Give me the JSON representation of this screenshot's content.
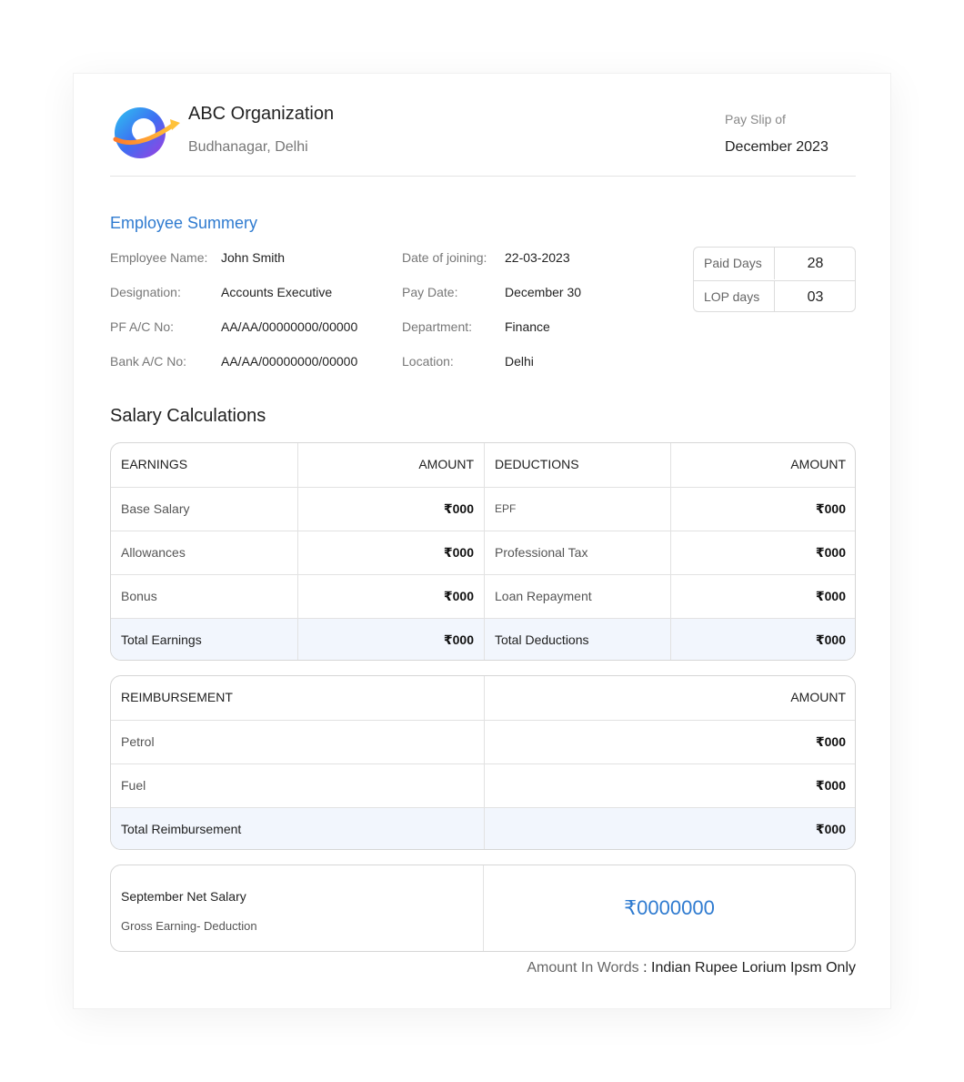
{
  "header": {
    "org_name": "ABC Organization",
    "org_address": "Budhanagar, Delhi",
    "payslip_label": "Pay Slip of",
    "payslip_month": "December 2023"
  },
  "summary": {
    "title": "Employee Summery",
    "left": [
      {
        "label": "Employee Name:",
        "value": "John Smith"
      },
      {
        "label": "Designation:",
        "value": "Accounts Executive"
      },
      {
        "label": "PF A/C No:",
        "value": "AA/AA/00000000/00000"
      },
      {
        "label": "Bank A/C No:",
        "value": "AA/AA/00000000/00000"
      }
    ],
    "right": [
      {
        "label": "Date of joining:",
        "value": "22-03-2023"
      },
      {
        "label": "Pay Date:",
        "value": "December 30"
      },
      {
        "label": "Department:",
        "value": "Finance"
      },
      {
        "label": "Location:",
        "value": "Delhi"
      }
    ],
    "days": [
      {
        "label": "Paid Days",
        "value": "28"
      },
      {
        "label": "LOP days",
        "value": "03"
      }
    ]
  },
  "calculations": {
    "title": "Salary Calculations",
    "headers": {
      "earnings": "EARNINGS",
      "amount": "AMOUNT",
      "deductions": "DEDUCTIONS"
    },
    "rows": [
      {
        "earning": "Base Salary",
        "earning_amount": "₹000",
        "deduction": "EPF",
        "deduction_amount": "₹000"
      },
      {
        "earning": "Allowances",
        "earning_amount": "₹000",
        "deduction": "Professional Tax",
        "deduction_amount": "₹000"
      },
      {
        "earning": "Bonus",
        "earning_amount": "₹000",
        "deduction": "Loan Repayment",
        "deduction_amount": "₹000"
      }
    ],
    "total": {
      "earning": "Total Earnings",
      "earning_amount": "₹000",
      "deduction": "Total Deductions",
      "deduction_amount": "₹000"
    }
  },
  "reimbursement": {
    "headers": {
      "label": "REIMBURSEMENT",
      "amount": "AMOUNT"
    },
    "rows": [
      {
        "label": "Petrol",
        "amount": "₹000"
      },
      {
        "label": "Fuel",
        "amount": "₹000"
      }
    ],
    "total": {
      "label": "Total Reimbursement",
      "amount": "₹000"
    }
  },
  "net": {
    "title": "September Net Salary",
    "subtitle": "Gross Earning- Deduction",
    "amount": "₹0000000"
  },
  "words": {
    "label": "Amount In Words",
    "value": ": Indian Rupee Lorium Ipsm Only"
  },
  "colors": {
    "accent": "#2f7bd0",
    "total_row": "#f2f6fd"
  }
}
